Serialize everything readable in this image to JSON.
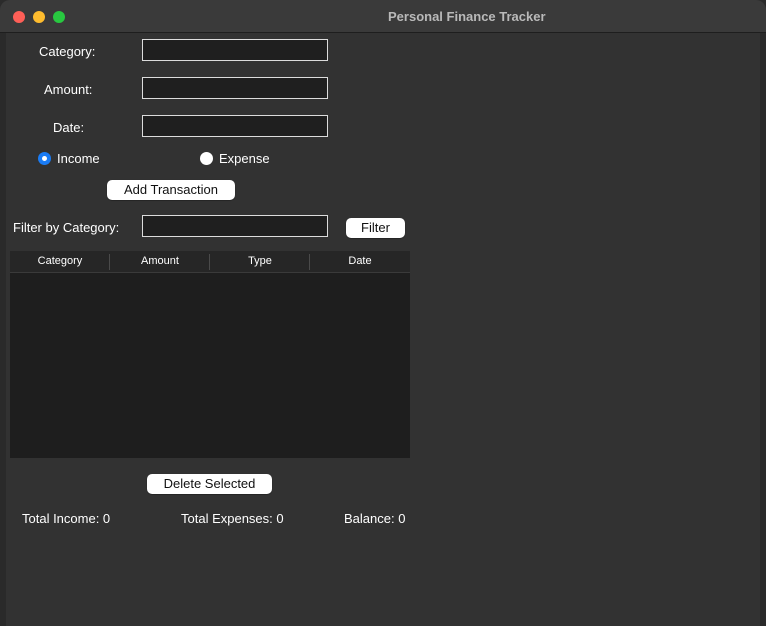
{
  "window": {
    "title": "Personal Finance Tracker"
  },
  "form": {
    "category_label": "Category:",
    "amount_label": "Amount:",
    "date_label": "Date:",
    "category_value": "",
    "amount_value": "",
    "date_value": "",
    "income_label": "Income",
    "expense_label": "Expense",
    "selected_type": "Income",
    "add_button_label": "Add Transaction"
  },
  "filter": {
    "label": "Filter by Category:",
    "value": "",
    "button_label": "Filter"
  },
  "table": {
    "columns": [
      "Category",
      "Amount",
      "Type",
      "Date"
    ],
    "rows": []
  },
  "actions": {
    "delete_button_label": "Delete Selected"
  },
  "summary": {
    "total_income": "Total Income: 0",
    "total_expenses": "Total Expenses: 0",
    "balance": "Balance: 0"
  },
  "colors": {
    "background": "#323232",
    "accent": "#1a7cf5"
  }
}
